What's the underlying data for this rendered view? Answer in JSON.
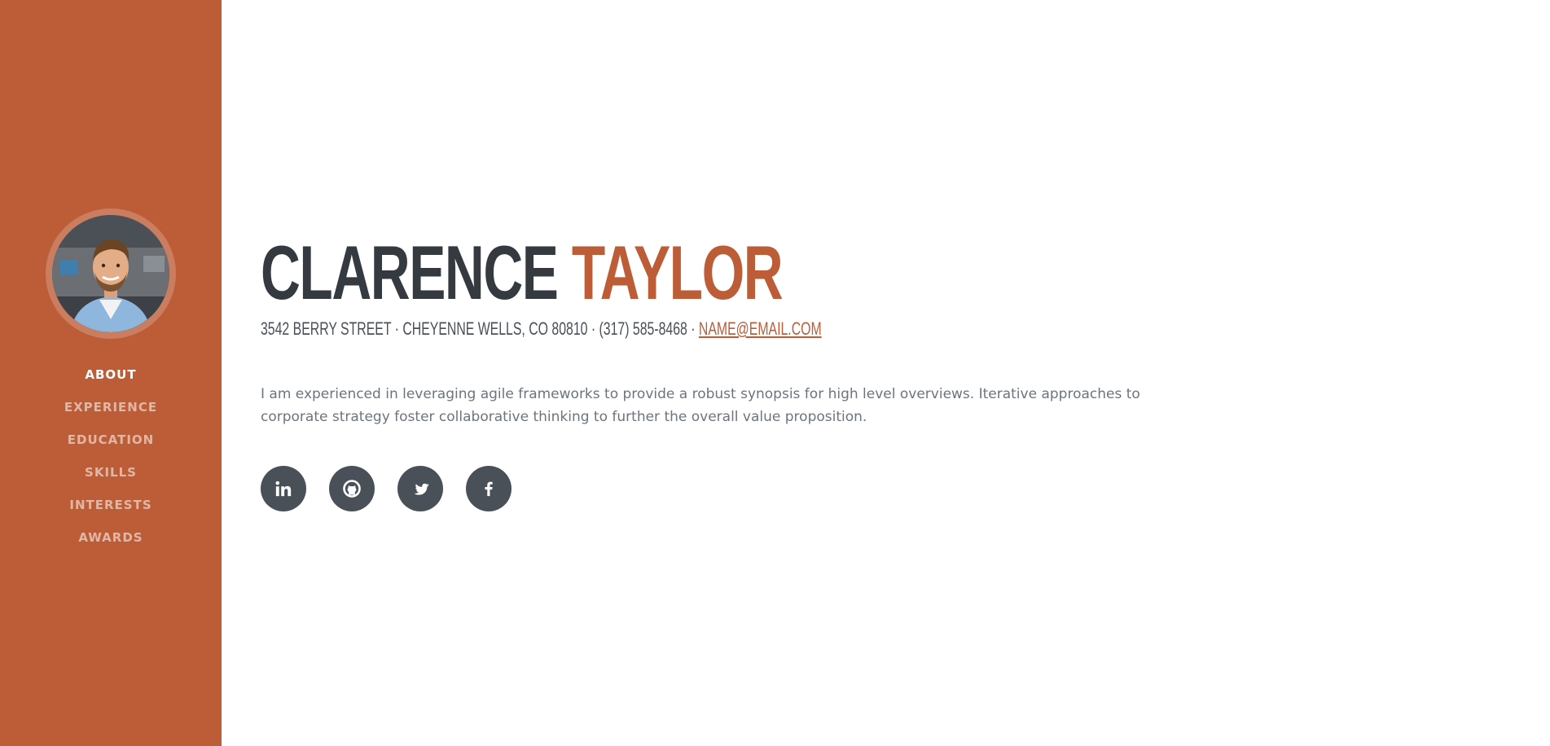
{
  "profile": {
    "first_name": "CLARENCE",
    "last_name": "TAYLOR",
    "address": "3542 BERRY STREET · CHEYENNE WELLS, CO 80810 · (317) 585-8468 · ",
    "email": "NAME@EMAIL.COM",
    "about": "I am experienced in leveraging agile frameworks to provide a robust synopsis for high level overviews. Iterative approaches to corporate strategy foster collaborative thinking to further the overall value proposition."
  },
  "nav": {
    "items": [
      {
        "label": "ABOUT",
        "active": true
      },
      {
        "label": "EXPERIENCE",
        "active": false
      },
      {
        "label": "EDUCATION",
        "active": false
      },
      {
        "label": "SKILLS",
        "active": false
      },
      {
        "label": "INTERESTS",
        "active": false
      },
      {
        "label": "AWARDS",
        "active": false
      }
    ]
  },
  "social": {
    "icons": [
      "linkedin-icon",
      "github-icon",
      "twitter-icon",
      "facebook-icon"
    ]
  },
  "colors": {
    "accent": "#bd5d38",
    "dark": "#343a40",
    "icon_bg": "#495057",
    "body_text": "#6c757d"
  }
}
